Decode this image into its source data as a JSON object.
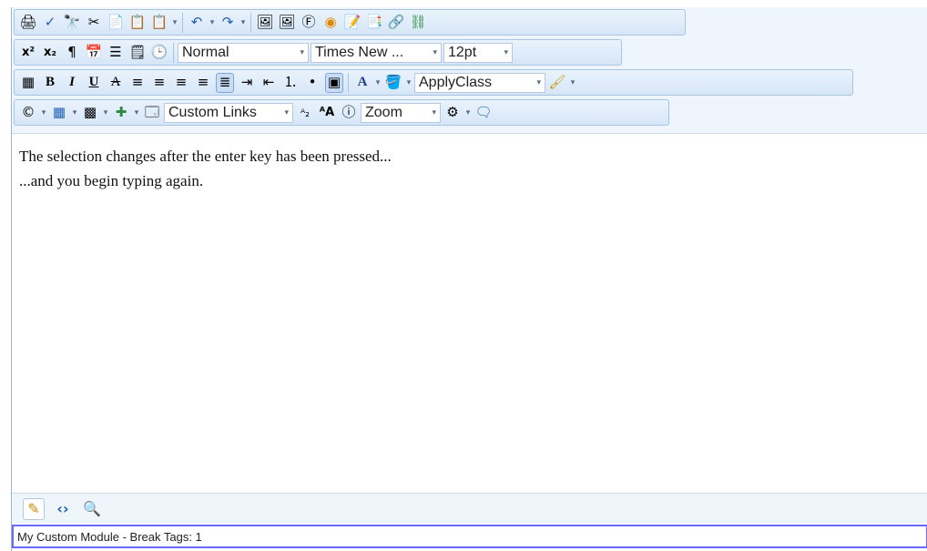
{
  "toolbar": {
    "format_block": "Normal",
    "font_name": "Times New ...",
    "font_size": "12pt",
    "apply_class": "ApplyClass",
    "custom_links": "Custom Links",
    "zoom": "Zoom"
  },
  "content": {
    "lines": [
      "The selection changes after the enter key has been pressed...",
      "...and you begin typing again."
    ]
  },
  "status": {
    "text": "My Custom Module - Break Tags: 1"
  }
}
